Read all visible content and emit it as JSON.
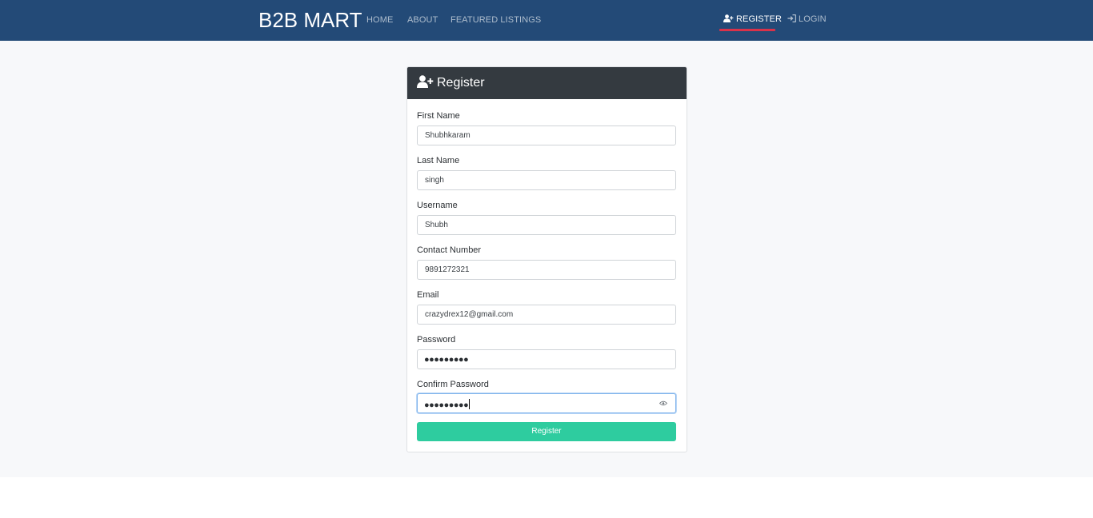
{
  "navbar": {
    "brand": "B2B MART",
    "links": [
      "HOME",
      "ABOUT",
      "FEATURED LISTINGS"
    ],
    "register": "REGISTER",
    "login": "LOGIN",
    "active": "REGISTER",
    "active_underline_color": "#d9324a",
    "bg_color": "#234a77"
  },
  "form": {
    "title": "Register",
    "fields": [
      {
        "label": "First Name",
        "value": "Shubhkaram"
      },
      {
        "label": "Last Name",
        "value": "singh"
      },
      {
        "label": "Username",
        "value": "Shubh"
      },
      {
        "label": "Contact Number",
        "value": "9891272321"
      },
      {
        "label": "Email",
        "value": "crazydrex12@gmail.com"
      },
      {
        "label": "Password",
        "value": "●●●●●●●●●"
      },
      {
        "label": "Confirm Password",
        "value": "●●●●●●●●●"
      }
    ],
    "submit_label": "Register",
    "submit_color": "#2ecc9f",
    "header_color": "#343a40",
    "focused_field": "Confirm Password"
  },
  "icons": {
    "register": "user-plus-icon",
    "login": "sign-in-icon",
    "reveal_password": "eye-icon"
  }
}
